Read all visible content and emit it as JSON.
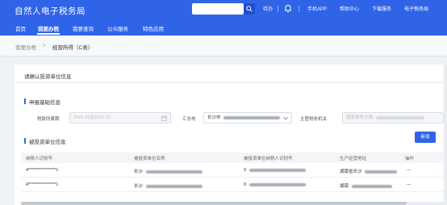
{
  "header": {
    "logo": "自然人电子税务局",
    "search_placeholder": "",
    "links": [
      "待办",
      "手机APP",
      "帮助中心",
      "下载服务",
      "电子税务局"
    ],
    "brand_color": "#2f64e8"
  },
  "nav": {
    "items": [
      "首页",
      "我要办税",
      "我要查询",
      "公众服务",
      "特色应用"
    ],
    "active": "我要办税"
  },
  "breadcrumb": {
    "root": "我要办税",
    "separator": ">",
    "current": "经营所得（C表）"
  },
  "card": {
    "title": "请确认投资单位信息"
  },
  "declare_info": {
    "section_title": "申报基础信息",
    "period_label": "税款所属期",
    "period_value": "2025-01至2025-12",
    "aggregate_label": "汇总地",
    "aggregate_value": "长沙市",
    "tax_office_label": "主管税务机关",
    "tax_office_value": "国家税务总局"
  },
  "invested_units": {
    "section_title": "被投资单位信息",
    "add_button": "新增",
    "columns": [
      "纳税人识别号",
      "被投资单位名称",
      "被投资单位纳税人识别号",
      "生产经营地址",
      "操作"
    ],
    "rows": [
      {
        "taxpayer_id": "4****************1",
        "unit_name": "长沙",
        "unit_tax_id": "9",
        "address": "湖南省长沙",
        "action": "---"
      },
      {
        "taxpayer_id": "4****************1",
        "unit_name": "长沙",
        "unit_tax_id": "9",
        "address": "湖南",
        "action": "---"
      }
    ]
  }
}
